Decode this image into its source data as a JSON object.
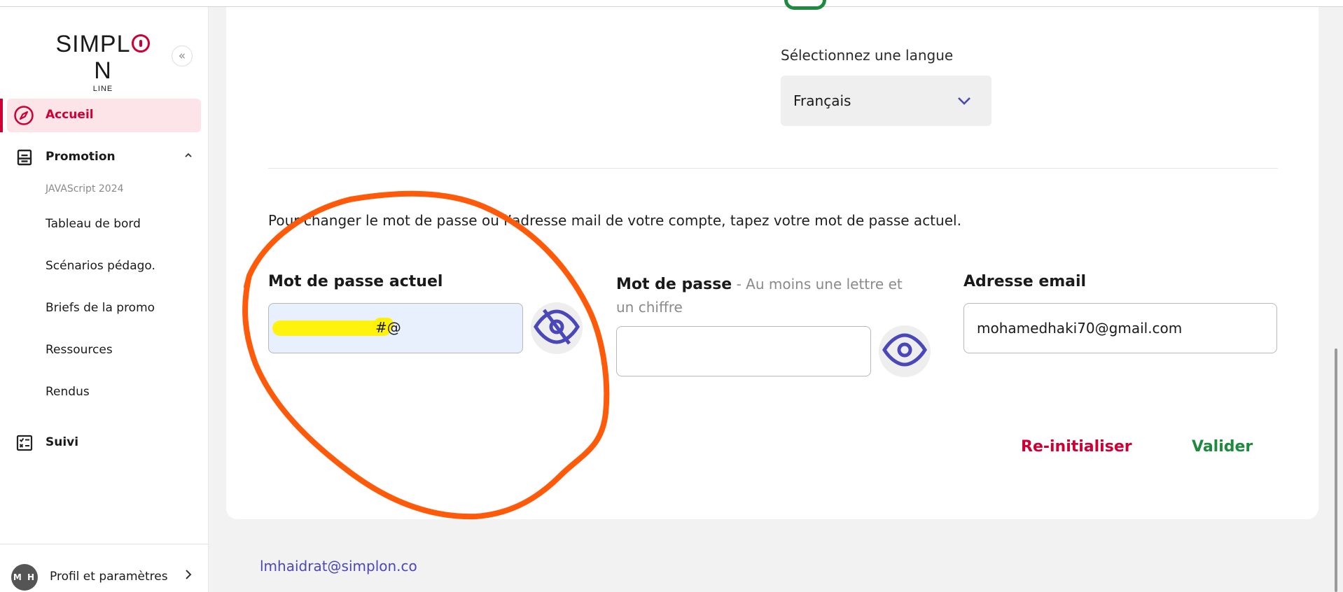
{
  "brand": {
    "logo_main_left": "SIMPL",
    "logo_main_right": "N",
    "logo_sub": "LINE"
  },
  "sidebar": {
    "collapse_glyph": "«",
    "items": [
      {
        "label": "Accueil",
        "icon": "compass-icon",
        "active": true
      },
      {
        "label": "Promotion",
        "icon": "clipboard-icon",
        "expanded": true
      },
      {
        "label": "Suivi",
        "icon": "checklist-icon"
      }
    ],
    "promo_year": "JAVAScript 2024",
    "promo_subitems": [
      "Tableau de bord",
      "Scénarios pédago.",
      "Briefs de la promo",
      "Ressources",
      "Rendus"
    ],
    "profile": {
      "initials": "M H",
      "label": "Profil et paramètres"
    }
  },
  "language": {
    "label": "Sélectionnez une langue",
    "selected": "Français"
  },
  "password_section": {
    "info": "Pour changer le mot de passe ou l’adresse mail de votre compte, tapez votre mot de passe actuel.",
    "current_password": {
      "label": "Mot de passe actuel",
      "visible_tail": "#@"
    },
    "new_password": {
      "label": "Mot de passe",
      "hint": " - Au moins une lettre et un chiffre",
      "value": ""
    },
    "email": {
      "label": "Adresse email",
      "value": "mohamedhaki70@gmail.com"
    },
    "reset_label": "Re-initialiser",
    "validate_label": "Valider"
  },
  "footer": {
    "email": "lmhaidrat@simplon.co"
  },
  "colors": {
    "accent": "#ce0033",
    "green": "#1e8a3d",
    "purple": "#4a48b8",
    "annotation": "#ff5a0a",
    "highlight": "#fff200"
  }
}
